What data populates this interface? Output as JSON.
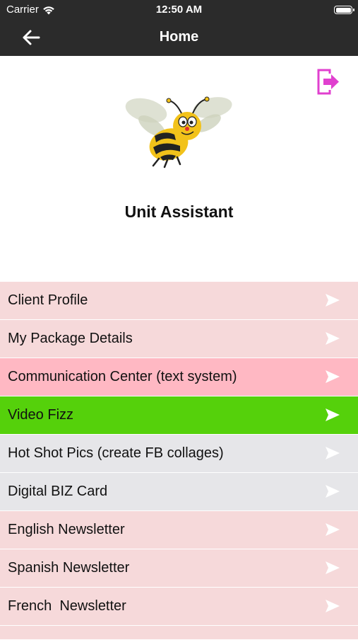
{
  "status_bar": {
    "carrier": "Carrier",
    "time": "12:50 AM"
  },
  "nav": {
    "title": "Home",
    "back_icon": "arrow-left-icon"
  },
  "header": {
    "app_title": "Unit Assistant",
    "logout_icon": "logout-icon",
    "mascot": "bee-mascot"
  },
  "colors": {
    "nav_bg": "#2b2b2b",
    "row_pink": "#f6d9da",
    "row_highlight": "#ffb8c3",
    "row_green": "#55d10b",
    "row_gray": "#e6e6e9",
    "accent_magenta": "#e040cf"
  },
  "menu": {
    "items": [
      {
        "label": "Client Profile",
        "bg": "#f6d9da"
      },
      {
        "label": "My Package Details",
        "bg": "#f6d9da"
      },
      {
        "label": "Communication Center (text system)",
        "bg": "#ffb8c3"
      },
      {
        "label": "Video Fizz",
        "bg": "#55d10b"
      },
      {
        "label": "Hot Shot Pics (create FB collages)",
        "bg": "#e6e6e9"
      },
      {
        "label": "Digital BIZ Card",
        "bg": "#e6e6e9"
      },
      {
        "label": "English Newsletter",
        "bg": "#f6d9da"
      },
      {
        "label": "Spanish Newsletter",
        "bg": "#f6d9da"
      },
      {
        "label": "French  Newsletter",
        "bg": "#f6d9da"
      }
    ]
  }
}
